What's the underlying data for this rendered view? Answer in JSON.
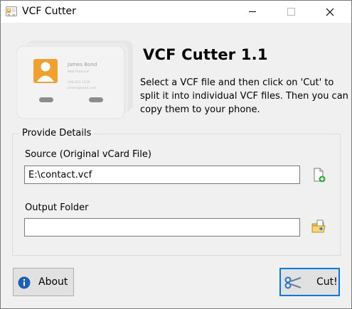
{
  "window": {
    "title": "VCF Cutter",
    "app_icon": "vcard-app-icon",
    "controls": {
      "minimize": "minimize-icon",
      "maximize": "maximize-icon",
      "close": "close-icon"
    }
  },
  "header": {
    "app_name": "VCF Cutter 1.1",
    "description": "Select a VCF file and then click on 'Cut' to split it into individual VCF files. Then you can copy them to your phone.",
    "hero_card": {
      "name": "James Bond",
      "title": "Web Producer",
      "phone": "408 623 1234",
      "email": "james@bond.com"
    }
  },
  "details": {
    "group_title": "Provide Details",
    "source_label": "Source (Original vCard File)",
    "source_value": "E:\\contact.vcf",
    "output_label": "Output Folder",
    "output_value": "",
    "browse_file_icon": "add-file-icon",
    "browse_folder_icon": "folder-icon"
  },
  "buttons": {
    "about": "About",
    "about_icon": "info-icon",
    "cut": "Cut!",
    "cut_icon": "scissors-icon"
  },
  "colors": {
    "accent": "#0078d7",
    "info_blue": "#1e5fb4",
    "card_orange": "#f0a030",
    "folder_yellow": "#e8c060"
  }
}
